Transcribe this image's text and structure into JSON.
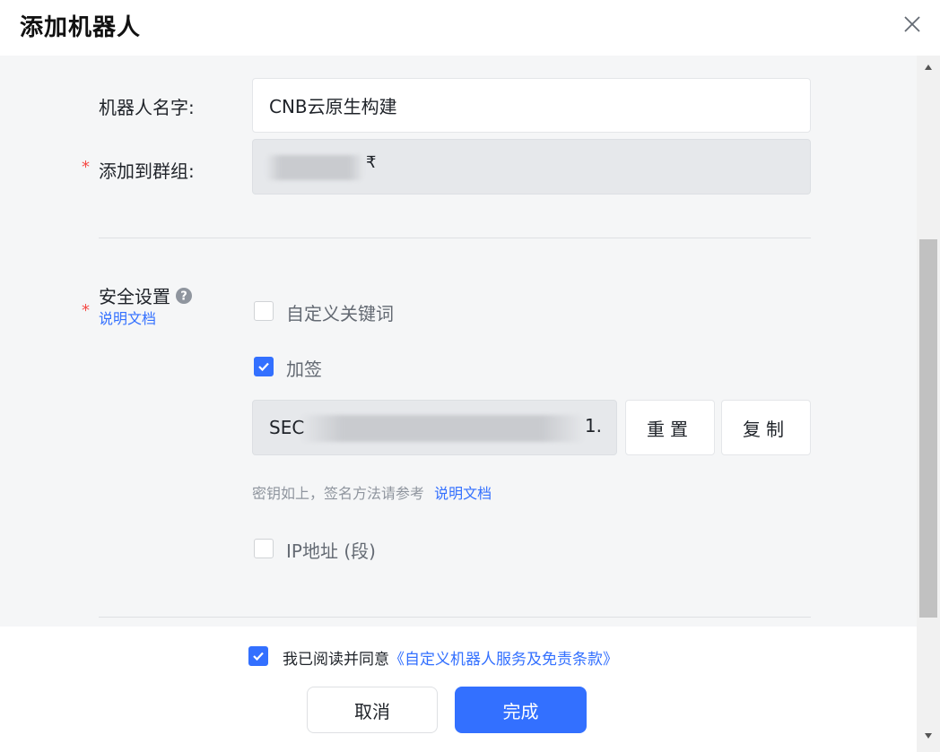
{
  "dialog": {
    "title": "添加机器人"
  },
  "form": {
    "name_label": "机器人名字:",
    "name_value": "CNB云原生构建",
    "group_label": "添加到群组:",
    "group_value_suffix": "₹",
    "security_label": "安全设置",
    "security_doc_link": "说明文档",
    "keyword_label": "自定义关键词",
    "keyword_checked": false,
    "sign_label": "加签",
    "sign_checked": true,
    "secret_prefix": "SEC",
    "secret_suffix": "1.",
    "reset_button": "重置",
    "copy_button": "复制",
    "hint_text": "密钥如上，签名方法请参考",
    "hint_link": "说明文档",
    "ip_label": "IP地址 (段)",
    "ip_checked": false
  },
  "footer": {
    "agree_text": "我已阅读并同意",
    "agree_link": "《自定义机器人服务及免责条款》",
    "agree_checked": true,
    "cancel_button": "取消",
    "done_button": "完成"
  },
  "colors": {
    "primary": "#3370ff",
    "required": "#f54a45",
    "panel_bg": "#f5f6f7"
  }
}
